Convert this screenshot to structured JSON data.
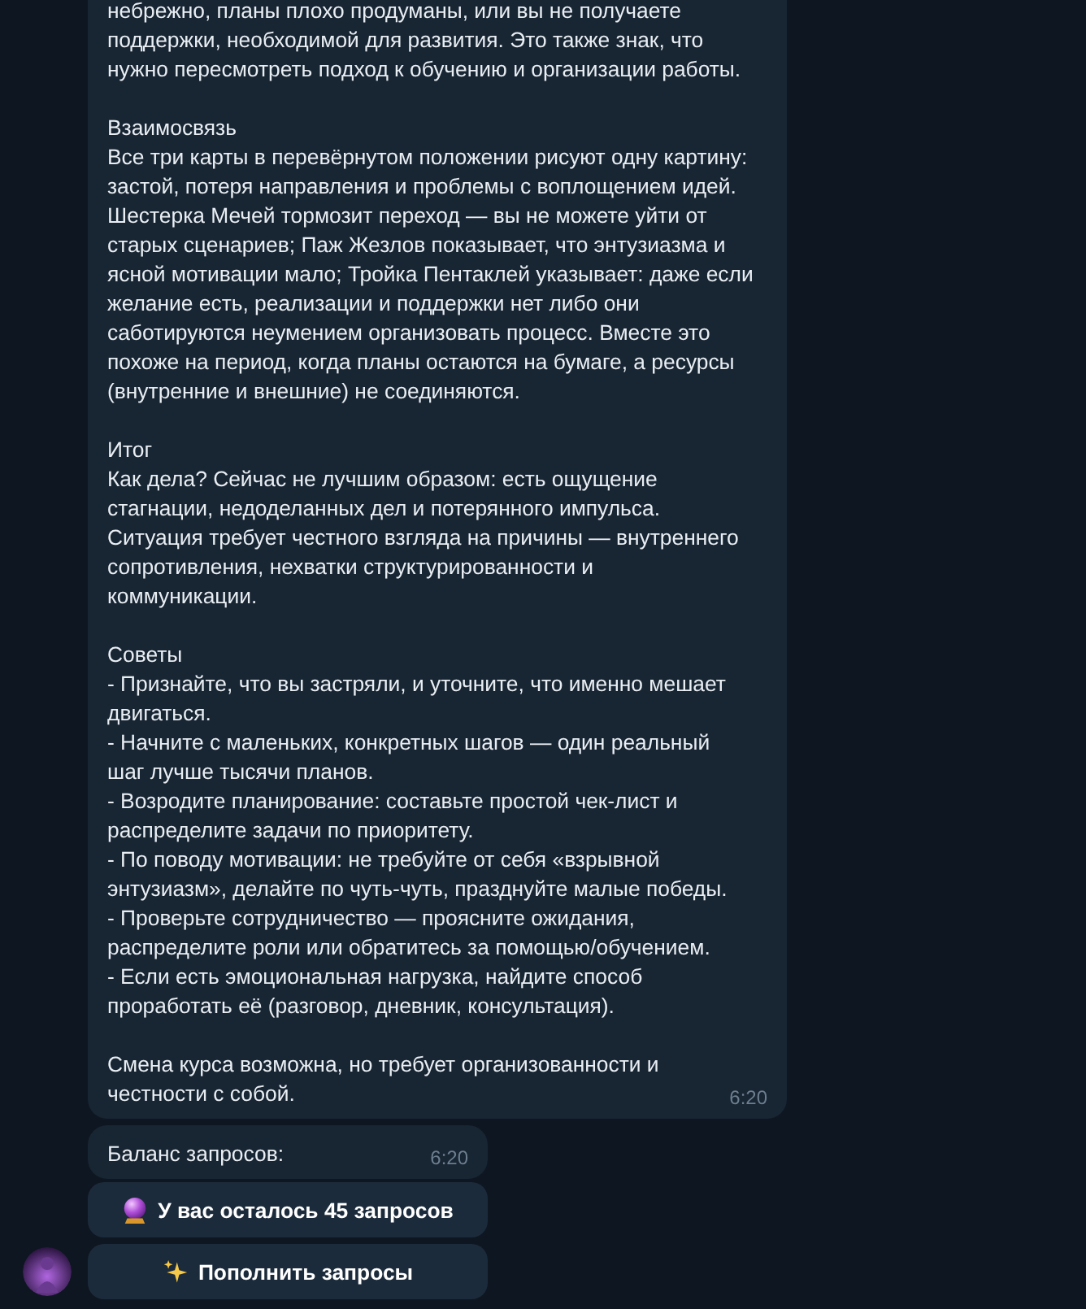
{
  "message": {
    "paragraphs": [
      "небрежно, планы плохо продуманы, или вы не получаете\nподдержки, необходимой для развития. Это также знак, что\nнужно пересмотреть подход к обучению и организации работы.",
      "Взаимосвязь\nВсе три карты в перевёрнутом положении рисуют одну картину:\nзастой, потеря направления и проблемы с воплощением идей.\nШестерка Мечей тормозит переход — вы не можете уйти от\nстарых сценариев; Паж Жезлов показывает, что энтузиазма и\nясной мотивации мало; Тройка Пентаклей указывает: даже если\nжелание есть, реализации и поддержки нет либо они\nсаботируются неумением организовать процесс. Вместе это\nпохоже на период, когда планы остаются на бумаге, а ресурсы\n(внутренние и внешние) не соединяются.",
      "Итог\nКак дела? Сейчас не лучшим образом: есть ощущение\nстагнации, недоделанных дел и потерянного импульса.\nСитуация требует честного взгляда на причины — внутреннего\nсопротивления, нехватки структурированности и\nкоммуникации.",
      "Советы\n- Признайте, что вы застряли, и уточните, что именно мешает\nдвигаться.\n- Начните с маленьких, конкретных шагов — один реальный\nшаг лучше тысячи планов.\n- Возродите планирование: составьте простой чек-лист и\nраспределите задачи по приоритету.\n- По поводу мотивации: не требуйте от себя «взрывной\nэнтузиазм», делайте по чуть-чуть, празднуйте малые победы.\n- Проверьте сотрудничество — проясните ожидания,\nраспределите роли или обратитесь за помощью/обучением.\n- Если есть эмоциональная нагрузка, найдите способ\nпроработать её (разговор, дневник, консультация).",
      "Смена курса возможна, но требует организованности и\nчестности с собой."
    ],
    "time": "6:20"
  },
  "balance_message": {
    "text": "Баланс запросов:",
    "time": "6:20"
  },
  "buttons": [
    {
      "label": "У вас осталось 45 запросов",
      "kind": "balance"
    },
    {
      "label": "Пополнить запросы",
      "kind": "top-up"
    }
  ]
}
